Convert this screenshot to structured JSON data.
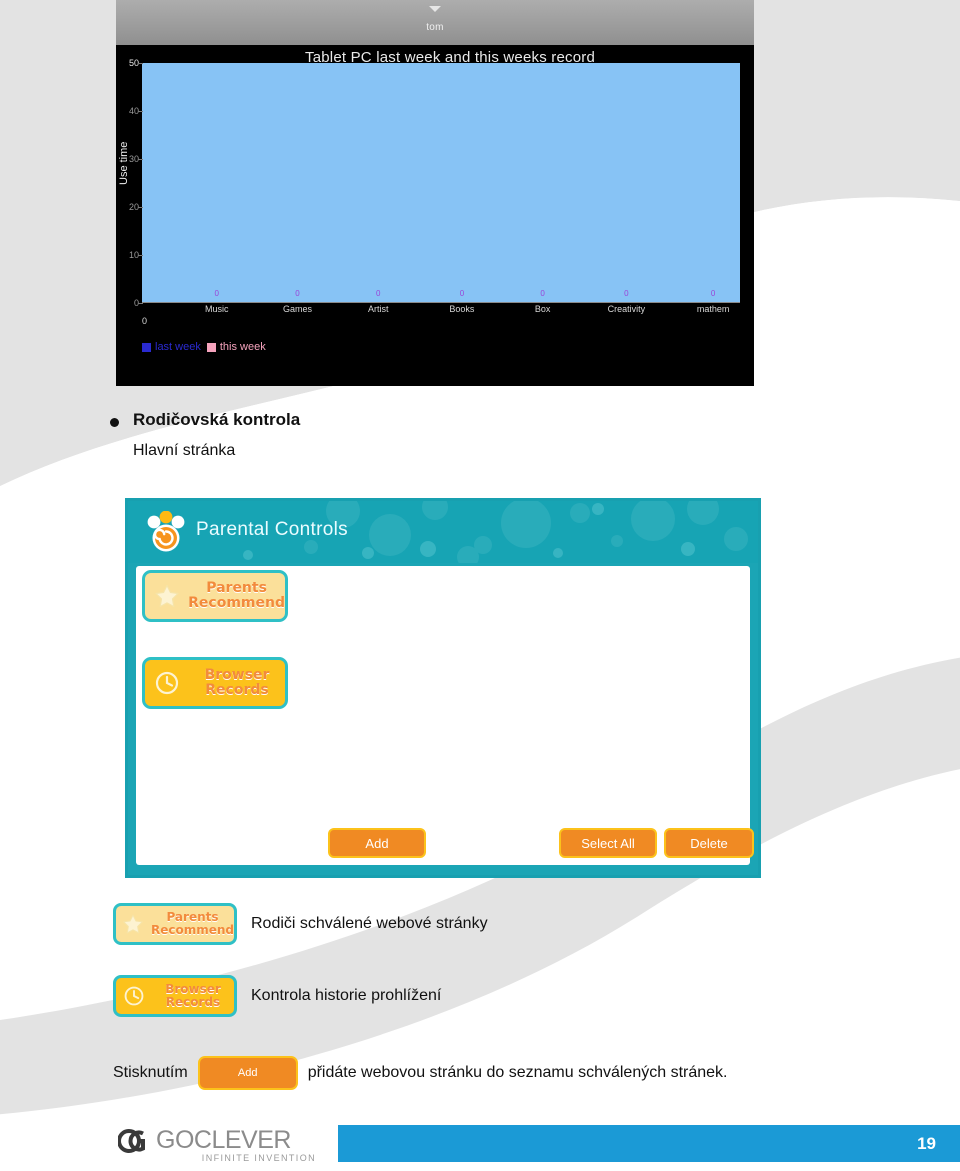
{
  "document": {
    "page_number": "19",
    "brand": {
      "logo_mark": "GO",
      "logo_word": "GOCLEVER",
      "tagline": "INFINITE INVENTION"
    }
  },
  "section": {
    "bullet_title": "Rodičovská kontrola",
    "subtitle": "Hlavní stránka"
  },
  "chart_screenshot": {
    "status_bar": {
      "user": "tom",
      "caret_icon": "chevron-down-icon"
    }
  },
  "chart_data": {
    "type": "bar",
    "title": "Tablet PC last week and this weeks record",
    "xlabel": "",
    "ylabel": "Use time",
    "categories": [
      "Music",
      "Games",
      "Artist",
      "Books",
      "Box",
      "Creativity",
      "mathem"
    ],
    "origin_label": "0",
    "ylim": [
      0,
      50
    ],
    "yticks": [
      "50",
      "40",
      "30",
      "20",
      "10",
      "0"
    ],
    "grid": false,
    "legend_position": "bottom-left",
    "series": [
      {
        "name": "last week",
        "color": "#2a2ad0",
        "values": [
          0,
          0,
          0,
          0,
          0,
          0,
          0
        ]
      },
      {
        "name": "this week",
        "color": "#f5a3bd",
        "values": [
          0,
          0,
          0,
          0,
          0,
          0,
          0
        ]
      }
    ],
    "data_labels": [
      "0",
      "0",
      "0",
      "0",
      "0",
      "0",
      "0"
    ],
    "plot_background": "#87c3f5",
    "canvas_background": "#000000"
  },
  "parental_controls": {
    "header_title": "Parental Controls",
    "header_icon": "paw-print-icon",
    "accent_color": "#17a4b4",
    "side_buttons": [
      {
        "line1": "Parents",
        "line2": "Recommend",
        "icon": "star-icon",
        "style": "pale"
      },
      {
        "line1": "Browser",
        "line2": "Records",
        "icon": "clock-icon",
        "style": "gold"
      }
    ],
    "action_buttons": [
      {
        "label": "Add"
      },
      {
        "label": "Select All"
      },
      {
        "label": "Delete"
      }
    ]
  },
  "captions": [
    {
      "button": {
        "line1": "Parents",
        "line2": "Recommend",
        "icon": "star-icon",
        "style": "pale"
      },
      "text": "Rodiči schválené webové stránky"
    },
    {
      "button": {
        "line1": "Browser",
        "line2": "Records",
        "icon": "clock-icon",
        "style": "gold"
      },
      "text": "Kontrola historie prohlížení"
    }
  ],
  "final_sentence": {
    "before": "Stisknutím",
    "chip_label": "Add",
    "after": "přidáte webovou stránku do seznamu schválených stránek."
  }
}
